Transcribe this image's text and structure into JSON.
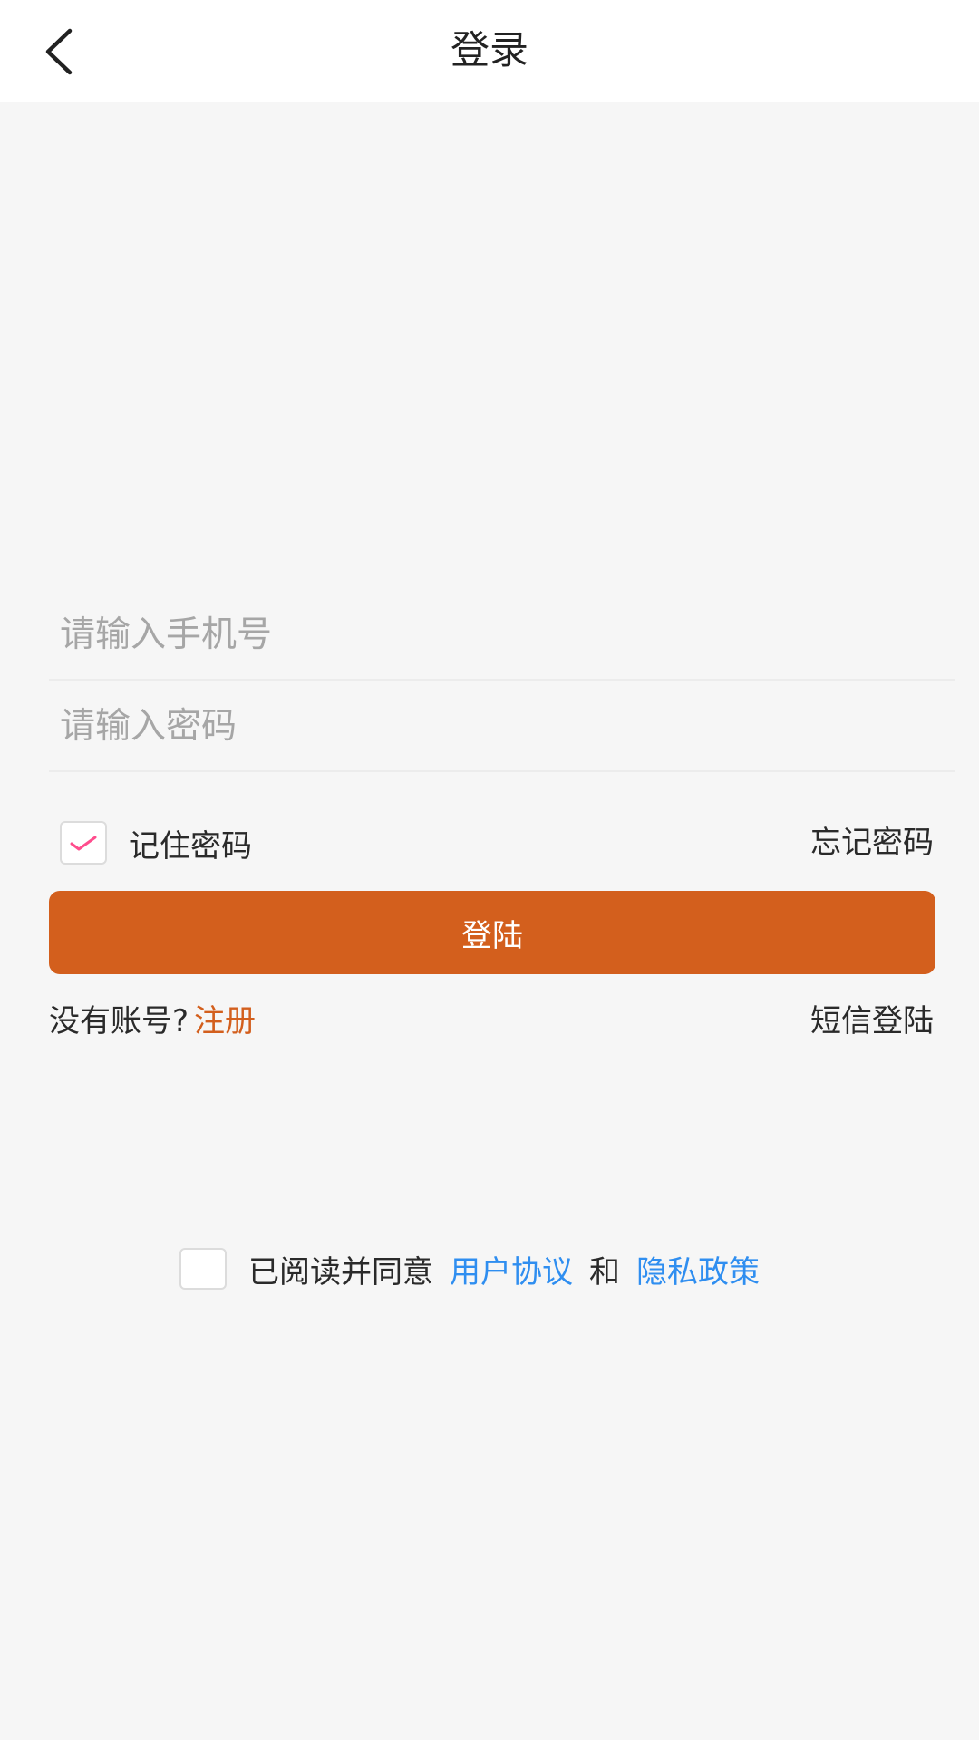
{
  "header": {
    "title": "登录",
    "back_icon": "chevron-left-icon"
  },
  "form": {
    "phone_placeholder": "请输入手机号",
    "phone_value": "",
    "password_placeholder": "请输入密码",
    "password_value": "",
    "remember_label": "记住密码",
    "remember_checked": true,
    "forgot_label": "忘记密码",
    "login_label": "登陆",
    "no_account_label": "没有账号?",
    "register_label": "注册",
    "sms_login_label": "短信登陆"
  },
  "agreement": {
    "checked": false,
    "prefix": "已阅读并同意",
    "user_agreement": "用户协议",
    "and": "和",
    "privacy_policy": "隐私政策"
  },
  "colors": {
    "accent": "#d35f1d",
    "link": "#2f8ef0",
    "check": "#ff4d8d",
    "background": "#f6f6f6"
  }
}
